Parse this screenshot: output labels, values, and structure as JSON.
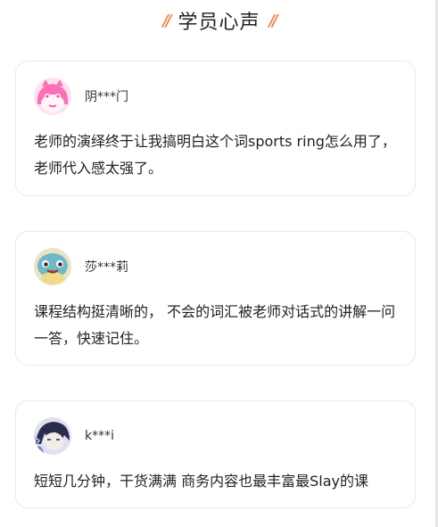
{
  "header": {
    "title": "学员心声",
    "left_mark": "//",
    "right_mark": "//",
    "accent_color": "#f0874a"
  },
  "testimonials": [
    {
      "avatar_icon": "pink-cartoon-avatar",
      "username": "阴***门",
      "text": "老师的演绎终于让我搞明白这个词sports ring怎么用了，老师代入感太强了。"
    },
    {
      "avatar_icon": "squirtle-avatar",
      "username": "莎***莉",
      "text": "课程结构挺清晰的， 不会的词汇被老师对话式的讲解一问一答，快速记住。"
    },
    {
      "avatar_icon": "anime-character-avatar",
      "username": "k***i",
      "text": "短短几分钟，干货满满 商务内容也最丰富最Slay的课"
    }
  ]
}
